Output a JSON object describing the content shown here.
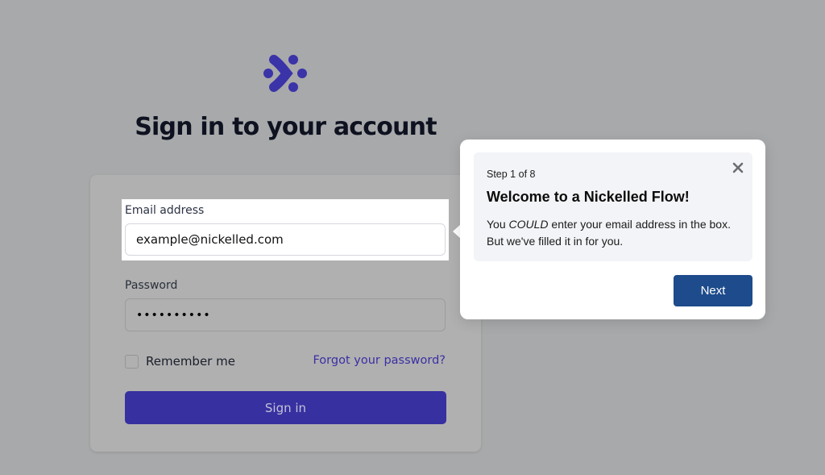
{
  "logo": {
    "name": "nickelled-logo",
    "color": "#3b33a8"
  },
  "page": {
    "title": "Sign in to your account"
  },
  "form": {
    "email_label": "Email address",
    "email_value": "example@nickelled.com",
    "password_label": "Password",
    "password_value": "••••••••••",
    "remember_label": "Remember me",
    "remember_checked": false,
    "forgot_link": "Forgot your password?",
    "signin_label": "Sign in"
  },
  "tooltip": {
    "step": "Step 1 of 8",
    "title": "Welcome to a Nickelled Flow!",
    "body_prefix": "You ",
    "body_emphasis": "COULD",
    "body_suffix": " enter your email address in the box. But we've filled it in for you.",
    "next_label": "Next",
    "close_icon": "close-icon"
  },
  "colors": {
    "overlay": "#a8a9aa",
    "brand": "#3730a0",
    "next_button": "#1d4b8b"
  }
}
